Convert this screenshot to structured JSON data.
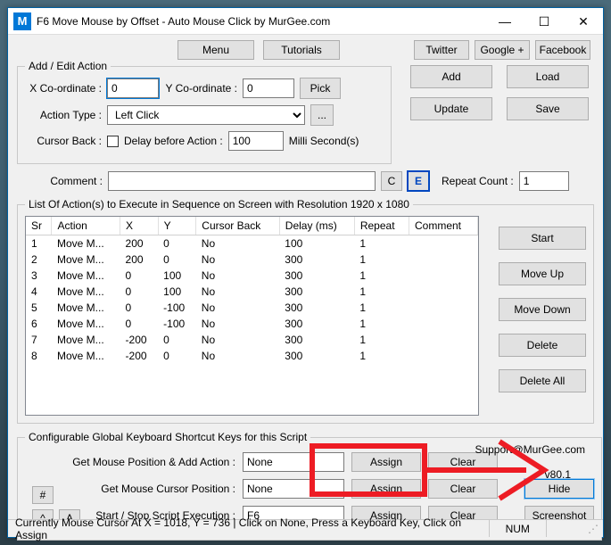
{
  "window": {
    "icon_letter": "M",
    "title": "F6 Move Mouse by Offset - Auto Mouse Click by MurGee.com",
    "min": "—",
    "max": "☐",
    "close": "✕"
  },
  "topbuttons": {
    "menu": "Menu",
    "tutorials": "Tutorials"
  },
  "links": {
    "twitter": "Twitter",
    "google": "Google +",
    "facebook": "Facebook"
  },
  "addedit": {
    "legend": "Add / Edit Action",
    "x_label": "X Co-ordinate :",
    "x_value": "0",
    "y_label": "Y Co-ordinate :",
    "y_value": "0",
    "pick": "Pick",
    "action_type_label": "Action Type :",
    "action_type_value": "Left Click",
    "ellipsis": "...",
    "cursor_back_label": "Cursor Back :",
    "delay_label": "Delay before Action :",
    "delay_value": "100",
    "delay_unit": "Milli Second(s)",
    "comment_label": "Comment :",
    "C": "C",
    "E": "E",
    "repeat_label": "Repeat Count :",
    "repeat_value": "1",
    "add": "Add",
    "load": "Load",
    "update": "Update",
    "save": "Save"
  },
  "list": {
    "legend": "List Of Action(s) to Execute in Sequence on Screen with Resolution 1920 x 1080",
    "headers": [
      "Sr",
      "Action",
      "X",
      "Y",
      "Cursor Back",
      "Delay (ms)",
      "Repeat",
      "Comment"
    ],
    "rows": [
      [
        "1",
        "Move M...",
        "200",
        "0",
        "No",
        "100",
        "1",
        ""
      ],
      [
        "2",
        "Move M...",
        "200",
        "0",
        "No",
        "300",
        "1",
        ""
      ],
      [
        "3",
        "Move M...",
        "0",
        "100",
        "No",
        "300",
        "1",
        ""
      ],
      [
        "4",
        "Move M...",
        "0",
        "100",
        "No",
        "300",
        "1",
        ""
      ],
      [
        "5",
        "Move M...",
        "0",
        "-100",
        "No",
        "300",
        "1",
        ""
      ],
      [
        "6",
        "Move M...",
        "0",
        "-100",
        "No",
        "300",
        "1",
        ""
      ],
      [
        "7",
        "Move M...",
        "-200",
        "0",
        "No",
        "300",
        "1",
        ""
      ],
      [
        "8",
        "Move M...",
        "-200",
        "0",
        "No",
        "300",
        "1",
        ""
      ]
    ],
    "start": "Start",
    "moveup": "Move Up",
    "movedown": "Move Down",
    "delete": "Delete",
    "deleteall": "Delete All"
  },
  "shortcuts": {
    "legend": "Configurable Global Keyboard Shortcut Keys for this Script",
    "support": "Support@MurGee.com",
    "version": "v80.1",
    "row1_label": "Get Mouse Position & Add Action :",
    "row1_value": "None",
    "row2_label": "Get Mouse Cursor Position :",
    "row2_value": "None",
    "row3_label": "Start / Stop Script Execution :",
    "row3_value": "F6",
    "assign": "Assign",
    "clear": "Clear",
    "hide": "Hide",
    "screenshot": "Screenshot",
    "hash": "#",
    "caret": "^",
    "A": "A"
  },
  "status": {
    "text": "Currently Mouse Cursor At X = 1018, Y = 736 | Click on None, Press a Keyboard Key, Click on Assign",
    "num": "NUM"
  }
}
